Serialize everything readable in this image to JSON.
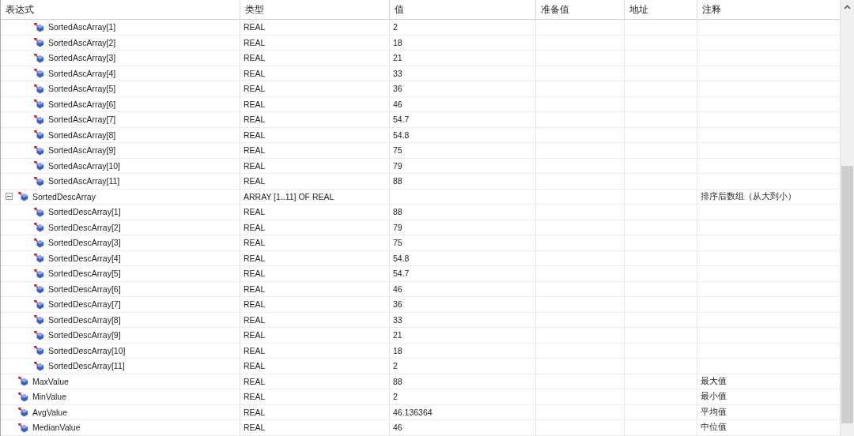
{
  "columns": [
    "表达式",
    "类型",
    "值",
    "准备值",
    "地址",
    "注释"
  ],
  "rows": [
    {
      "kind": "continued",
      "children": [
        {
          "name": "SortedAscArray[1]",
          "type": "REAL",
          "value": "2"
        },
        {
          "name": "SortedAscArray[2]",
          "type": "REAL",
          "value": "18"
        },
        {
          "name": "SortedAscArray[3]",
          "type": "REAL",
          "value": "21"
        },
        {
          "name": "SortedAscArray[4]",
          "type": "REAL",
          "value": "33"
        },
        {
          "name": "SortedAscArray[5]",
          "type": "REAL",
          "value": "36"
        },
        {
          "name": "SortedAscArray[6]",
          "type": "REAL",
          "value": "46"
        },
        {
          "name": "SortedAscArray[7]",
          "type": "REAL",
          "value": "54.7"
        },
        {
          "name": "SortedAscArray[8]",
          "type": "REAL",
          "value": "54.8"
        },
        {
          "name": "SortedAscArray[9]",
          "type": "REAL",
          "value": "75"
        },
        {
          "name": "SortedAscArray[10]",
          "type": "REAL",
          "value": "79"
        },
        {
          "name": "SortedAscArray[11]",
          "type": "REAL",
          "value": "88"
        }
      ]
    },
    {
      "kind": "variable",
      "name": "SortedDescArray",
      "type": "ARRAY [1..11] OF REAL",
      "comment": "排序后数组（从大到小）",
      "expanded": true,
      "children": [
        {
          "name": "SortedDescArray[1]",
          "type": "REAL",
          "value": "88"
        },
        {
          "name": "SortedDescArray[2]",
          "type": "REAL",
          "value": "79"
        },
        {
          "name": "SortedDescArray[3]",
          "type": "REAL",
          "value": "75"
        },
        {
          "name": "SortedDescArray[4]",
          "type": "REAL",
          "value": "54.8"
        },
        {
          "name": "SortedDescArray[5]",
          "type": "REAL",
          "value": "54.7"
        },
        {
          "name": "SortedDescArray[6]",
          "type": "REAL",
          "value": "46"
        },
        {
          "name": "SortedDescArray[7]",
          "type": "REAL",
          "value": "36"
        },
        {
          "name": "SortedDescArray[8]",
          "type": "REAL",
          "value": "33"
        },
        {
          "name": "SortedDescArray[9]",
          "type": "REAL",
          "value": "21"
        },
        {
          "name": "SortedDescArray[10]",
          "type": "REAL",
          "value": "18"
        },
        {
          "name": "SortedDescArray[11]",
          "type": "REAL",
          "value": "2"
        }
      ]
    },
    {
      "kind": "variable",
      "name": "MaxValue",
      "type": "REAL",
      "value": "88",
      "comment": "最大值"
    },
    {
      "kind": "variable",
      "name": "MinValue",
      "type": "REAL",
      "value": "2",
      "comment": "最小值"
    },
    {
      "kind": "variable",
      "name": "AvgValue",
      "type": "REAL",
      "value": "46.136364",
      "comment": "平均值"
    },
    {
      "kind": "variable",
      "name": "MedianValue",
      "type": "REAL",
      "value": "46",
      "comment": "中位值"
    }
  ]
}
